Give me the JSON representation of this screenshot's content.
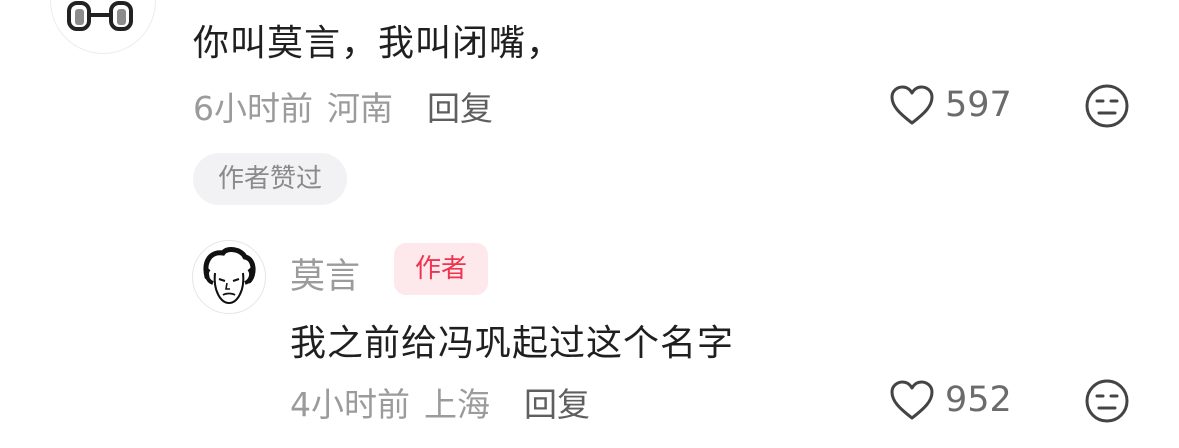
{
  "comment": {
    "text": "你叫莫言，我叫闭嘴，",
    "time": "6小时前",
    "location": "河南",
    "reply_label": "回复",
    "like_count": "597",
    "author_liked_tag": "作者赞过"
  },
  "reply": {
    "username": "莫言",
    "author_badge": "作者",
    "text": "我之前给冯巩起过这个名字",
    "time": "4小时前",
    "location": "上海",
    "reply_label": "回复",
    "like_count": "952"
  },
  "icons": {
    "like": "heart-outline-icon",
    "dislike": "unamused-face-icon"
  },
  "colors": {
    "author_badge_text": "#f0334f",
    "author_badge_bg": "#fde9ec",
    "meta_text": "#9b9b9b"
  }
}
